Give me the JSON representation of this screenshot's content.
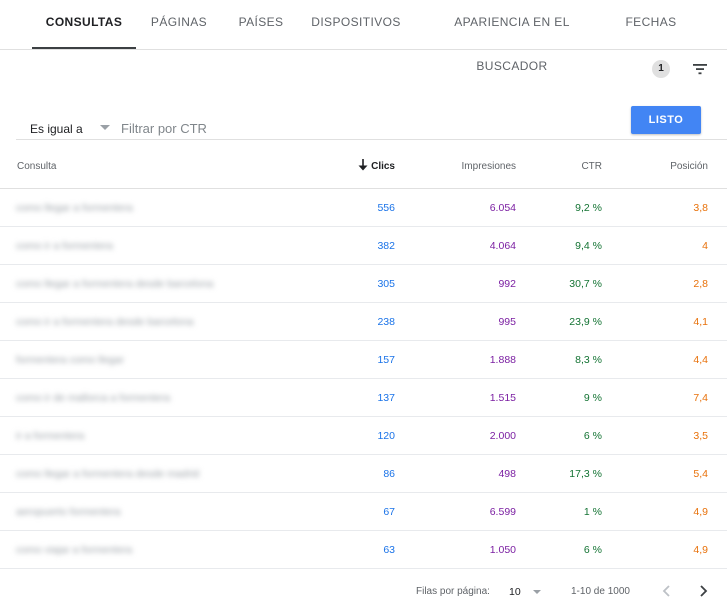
{
  "tabs": [
    {
      "label": "CONSULTAS",
      "active": true
    },
    {
      "label": "PÁGINAS",
      "active": false
    },
    {
      "label": "PAÍSES",
      "active": false
    },
    {
      "label": "DISPOSITIVOS",
      "active": false
    },
    {
      "label": "APARIENCIA EN EL BUSCADOR",
      "active": false
    },
    {
      "label": "FECHAS",
      "active": false
    }
  ],
  "filter_bar": {
    "active_count": "1",
    "filter_icon": "filter-list-icon"
  },
  "filter": {
    "operator": "Es igual a",
    "placeholder": "Filtrar por CTR",
    "value": "",
    "done_label": "LISTO",
    "done_color": "#4285f4"
  },
  "table": {
    "columns": {
      "query": "Consulta",
      "clicks": "Clics",
      "impressions": "Impresiones",
      "ctr": "CTR",
      "position": "Posición"
    },
    "sorted_column": "clicks",
    "colors": {
      "clicks": "#1a73e8",
      "impressions": "#7b1fa2",
      "ctr": "#137333",
      "position": "#e8710a"
    },
    "rows": [
      {
        "query": "como llegar a formentera",
        "clicks": "556",
        "impressions": "6.054",
        "ctr": "9,2 %",
        "position": "3,8"
      },
      {
        "query": "como ir a formentera",
        "clicks": "382",
        "impressions": "4.064",
        "ctr": "9,4 %",
        "position": "4"
      },
      {
        "query": "como llegar a formentera desde barcelona",
        "clicks": "305",
        "impressions": "992",
        "ctr": "30,7 %",
        "position": "2,8"
      },
      {
        "query": "como ir a formentera desde barcelona",
        "clicks": "238",
        "impressions": "995",
        "ctr": "23,9 %",
        "position": "4,1"
      },
      {
        "query": "formentera como llegar",
        "clicks": "157",
        "impressions": "1.888",
        "ctr": "8,3 %",
        "position": "4,4"
      },
      {
        "query": "como ir de mallorca a formentera",
        "clicks": "137",
        "impressions": "1.515",
        "ctr": "9 %",
        "position": "7,4"
      },
      {
        "query": "ir a formentera",
        "clicks": "120",
        "impressions": "2.000",
        "ctr": "6 %",
        "position": "3,5"
      },
      {
        "query": "como llegar a formentera desde madrid",
        "clicks": "86",
        "impressions": "498",
        "ctr": "17,3 %",
        "position": "5,4"
      },
      {
        "query": "aeropuerto formentera",
        "clicks": "67",
        "impressions": "6.599",
        "ctr": "1 %",
        "position": "4,9"
      },
      {
        "query": "como viajar a formentera",
        "clicks": "63",
        "impressions": "1.050",
        "ctr": "6 %",
        "position": "4,9"
      }
    ]
  },
  "pagination": {
    "rows_per_page_label": "Filas por página:",
    "rows_per_page": "10",
    "range": "1-10 de 1000",
    "prev_icon": "chevron-left-icon",
    "next_icon": "chevron-right-icon"
  }
}
